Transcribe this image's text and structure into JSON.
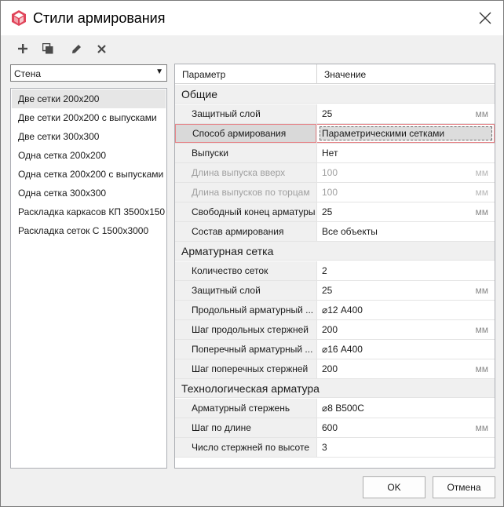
{
  "window": {
    "title": "Стили армирования",
    "accent_color": "#e0455a"
  },
  "toolbar": {
    "add_icon": "plus-icon",
    "copy_icon": "copy-icon",
    "edit_icon": "pencil-icon",
    "delete_icon": "cross-icon"
  },
  "element_type": {
    "selected": "Стена"
  },
  "styles": [
    {
      "label": "Две сетки 200x200",
      "selected": true
    },
    {
      "label": "Две сетки 200x200 с выпусками",
      "selected": false
    },
    {
      "label": "Две сетки 300x300",
      "selected": false
    },
    {
      "label": "Одна сетка 200x200",
      "selected": false
    },
    {
      "label": "Одна сетка 200x200 с выпусками",
      "selected": false
    },
    {
      "label": "Одна сетка 300x300",
      "selected": false
    },
    {
      "label": "Раскладка каркасов КП 3500x150",
      "selected": false
    },
    {
      "label": "Раскладка сеток С 1500x3000",
      "selected": false
    }
  ],
  "grid": {
    "col_param": "Параметр",
    "col_value": "Значение",
    "categories": [
      {
        "name": "Общие",
        "rows": [
          {
            "name": "Защитный слой",
            "value": "25",
            "unit": "мм"
          },
          {
            "name": "Способ армирования",
            "value": "Параметрическими сетками",
            "unit": "",
            "selected": true
          },
          {
            "name": "Выпуски",
            "value": "Нет",
            "unit": ""
          },
          {
            "name": "Длина выпуска вверх",
            "value": "100",
            "unit": "мм",
            "disabled": true
          },
          {
            "name": "Длина выпусков по торцам",
            "value": "100",
            "unit": "мм",
            "disabled": true
          },
          {
            "name": "Свободный конец арматуры",
            "value": "25",
            "unit": "мм"
          },
          {
            "name": "Состав армирования",
            "value": "Все объекты",
            "unit": ""
          }
        ]
      },
      {
        "name": "Арматурная сетка",
        "rows": [
          {
            "name": "Количество сеток",
            "value": "2",
            "unit": ""
          },
          {
            "name": "Защитный слой",
            "value": "25",
            "unit": "мм"
          },
          {
            "name": "Продольный арматурный ...",
            "value": "⌀12 А400",
            "unit": ""
          },
          {
            "name": "Шаг продольных стержней",
            "value": "200",
            "unit": "мм"
          },
          {
            "name": "Поперечный арматурный ...",
            "value": "⌀16 А400",
            "unit": ""
          },
          {
            "name": "Шаг поперечных стержней",
            "value": "200",
            "unit": "мм"
          }
        ]
      },
      {
        "name": "Технологическая арматура",
        "rows": [
          {
            "name": "Арматурный стержень",
            "value": "⌀8 В500С",
            "unit": ""
          },
          {
            "name": "Шаг по длине",
            "value": "600",
            "unit": "мм"
          },
          {
            "name": "Число стержней по высоте",
            "value": "3",
            "unit": ""
          }
        ]
      }
    ]
  },
  "buttons": {
    "ok": "OK",
    "cancel": "Отмена"
  }
}
